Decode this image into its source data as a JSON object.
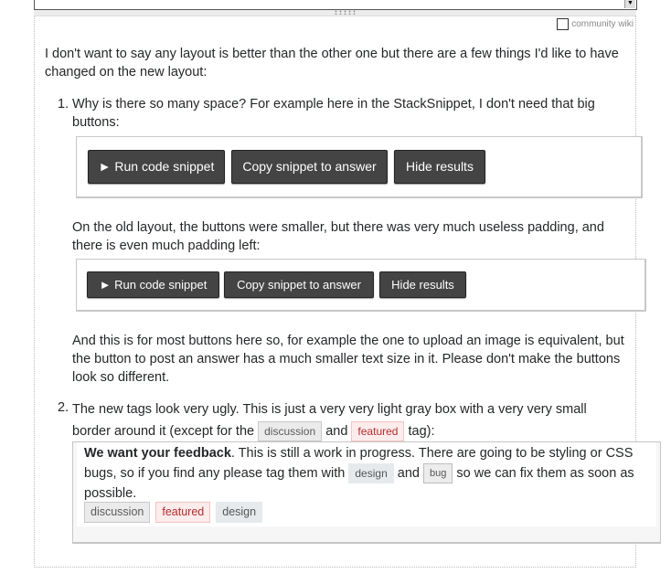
{
  "editor": {
    "scroll_arrow_icon": "▼"
  },
  "preview": {
    "community_wiki_label": "community wiki",
    "intro": "I don't want to say any layout is better than the other one but there are a few things I'd like to have changed on the new layout:",
    "items": [
      {
        "number": "1.",
        "text": "Why is there so many space? For example here in the StackSnippet, I don't need that big buttons:",
        "new_snippet_buttons": [
          "► Run code snippet",
          "Copy snippet to answer",
          "Hide results"
        ],
        "old_layout_text": "On the old layout, the buttons were smaller, but there was very much useless padding, and there is even much padding left:",
        "old_snippet_buttons": [
          "► Run code snippet",
          "Copy snippet to answer",
          "Hide results"
        ],
        "closing_text": "And this is for most buttons here so, for example the one to upload an image is equivalent, but the button to post an answer has a much smaller text size in it. Please don't make the buttons look so different."
      },
      {
        "number": "2.",
        "text_before": "The new tags look very ugly. This is just a very very light gray box with a very very small border around it (except for the",
        "tag_a": "discussion",
        "text_and": "and",
        "tag_b": "featured",
        "text_after": "tag):"
      }
    ],
    "notice": {
      "bold": "We want your feedback",
      "text1": ". This is still a work in progress. There are going to be styling or CSS bugs, so if you find any please tag them with",
      "tag_design": "design",
      "text_and": "and",
      "tag_bug": "bug",
      "text2": "so we can fix them as soon as possible.",
      "tags": [
        "discussion",
        "featured",
        "design"
      ]
    }
  }
}
